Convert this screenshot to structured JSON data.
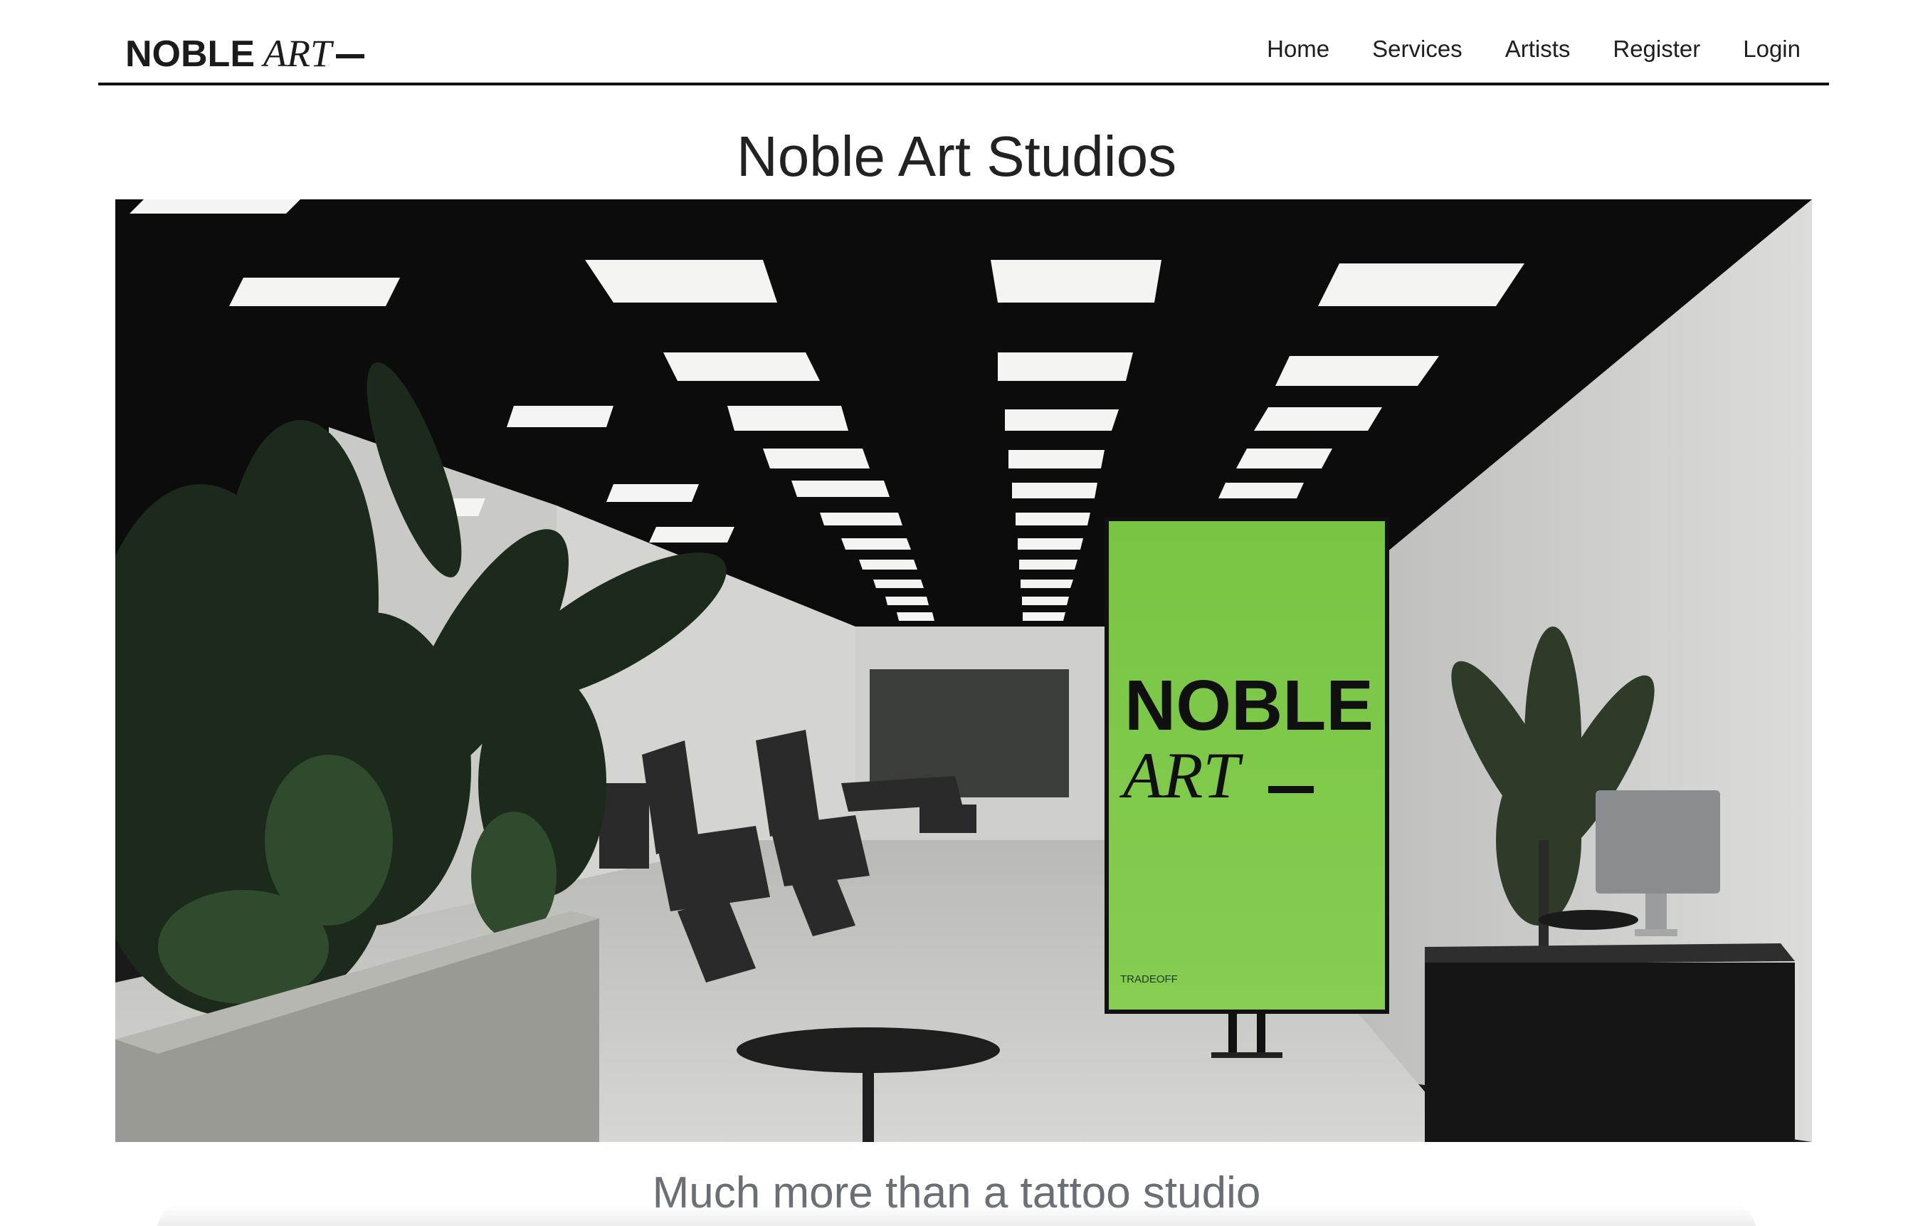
{
  "brand": {
    "name_strong": "NOBLE",
    "name_italic": "ART"
  },
  "nav": {
    "items": [
      {
        "label": "Home"
      },
      {
        "label": "Services"
      },
      {
        "label": "Artists"
      },
      {
        "label": "Register"
      },
      {
        "label": "Login"
      }
    ]
  },
  "main": {
    "title": "Noble Art Studios",
    "hero": {
      "sign_line1": "NOBLE",
      "sign_line2": "ART",
      "sign_small": "TRADEOFF",
      "sign_color": "#7fc94a"
    },
    "tagline": "Much more than a tattoo studio"
  },
  "colors": {
    "text": "#222222",
    "tagline": "#6b6f75",
    "nav_border": "#111111"
  }
}
